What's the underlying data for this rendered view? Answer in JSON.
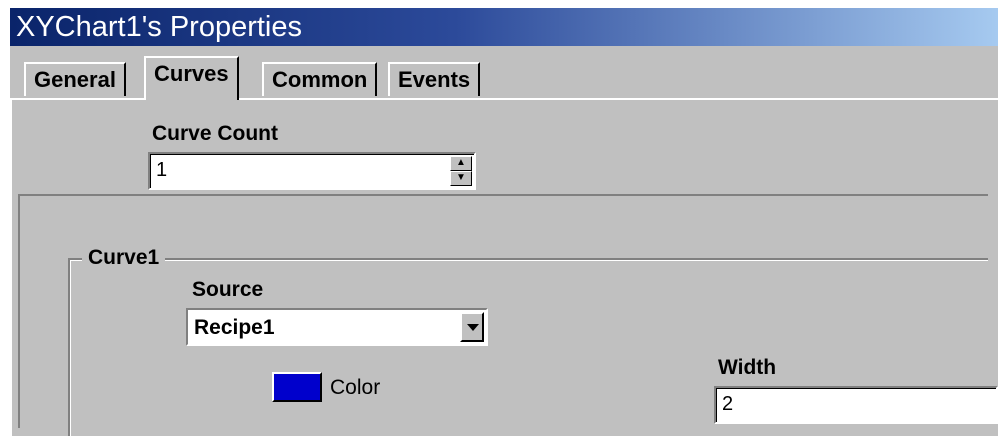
{
  "window": {
    "title": "XYChart1's Properties"
  },
  "tabs": [
    {
      "label": "General"
    },
    {
      "label": "Curves"
    },
    {
      "label": "Common"
    },
    {
      "label": "Events"
    }
  ],
  "curve_count": {
    "label": "Curve Count",
    "value": "1"
  },
  "curve_group": {
    "legend": "Curve1",
    "source": {
      "label": "Source",
      "value": "Recipe1"
    },
    "color": {
      "label": "Color",
      "value": "#0000cc"
    },
    "width": {
      "label": "Width",
      "value": "2"
    }
  },
  "colors": {
    "titlebar_start": "#0a246a",
    "dialog_face": "#c0c0c0"
  }
}
